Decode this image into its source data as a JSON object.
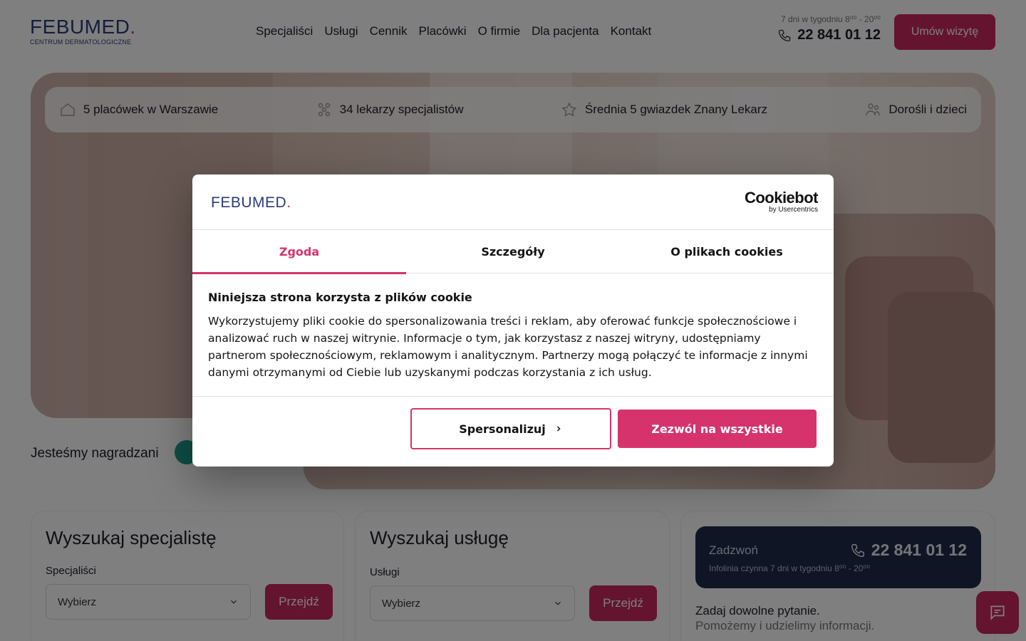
{
  "colors": {
    "brand": "#2a3d7a",
    "accent": "#c8285f",
    "cookie_accent": "#d6336c",
    "dark_card": "#1e2a4a"
  },
  "header": {
    "logo_text": "FEBUMED",
    "logo_sub": "CENTRUM DERMATOLOGICZNE",
    "nav": [
      "Specjaliści",
      "Usługi",
      "Cennik",
      "Placówki",
      "O firmie",
      "Dla pacjenta",
      "Kontakt"
    ],
    "hours": "7 dni w tygodniu 8⁰⁰ - 20⁰⁰",
    "phone": "22 841 01 12",
    "cta": "Umów wizytę"
  },
  "stats": [
    {
      "icon": "home-icon",
      "text": "5 placówek w Warszawie"
    },
    {
      "icon": "doctors-icon",
      "text": "34 lekarzy specjalistów"
    },
    {
      "icon": "star-icon",
      "text": "Średnia 5 gwiazdek Znany Lekarz"
    },
    {
      "icon": "people-icon",
      "text": "Dorośli i dzieci"
    }
  ],
  "awards": {
    "label": "Jesteśmy nagradzani"
  },
  "search_specialist": {
    "title": "Wyszukaj specjalistę",
    "label": "Specjaliści",
    "select": "Wybierz",
    "button": "Przejdź"
  },
  "search_service": {
    "title": "Wyszukaj usługę",
    "label": "Usługi",
    "select": "Wybierz",
    "button": "Przejdź"
  },
  "call": {
    "label": "Zadzwoń",
    "phone": "22 841 01 12",
    "info": "Infolinia czynna 7 dni w tygodniu 8⁰⁰ - 20⁰⁰",
    "q1": "Zadaj dowolne pytanie.",
    "q2": "Pomożemy i udzielimy informacji."
  },
  "cookie": {
    "logo": "FEBUMED",
    "provider": "Cookiebot",
    "provider_sub": "by Usercentrics",
    "tabs": [
      "Zgoda",
      "Szczegóły",
      "O plikach cookies"
    ],
    "heading": "Niniejsza strona korzysta z plików cookie",
    "text": "Wykorzystujemy pliki cookie do spersonalizowania treści i reklam, aby oferować funkcje społecznościowe i analizować ruch w naszej witrynie. Informacje o tym, jak korzystasz z naszej witryny, udostępniamy partnerom społecznościowym, reklamowym i analitycznym. Partnerzy mogą połączyć te informacje z innymi danymi otrzymanymi od Ciebie lub uzyskanymi podczas korzystania z ich usług.",
    "btn_personalize": "Spersonalizuj",
    "btn_allow": "Zezwól na wszystkie"
  }
}
